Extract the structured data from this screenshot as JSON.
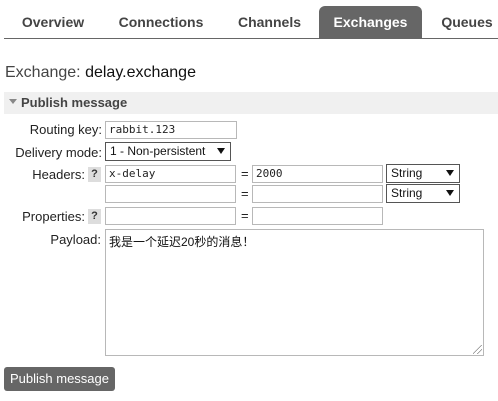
{
  "tabs": [
    {
      "label": "Overview"
    },
    {
      "label": "Connections"
    },
    {
      "label": "Channels"
    },
    {
      "label": "Exchanges",
      "active": true
    },
    {
      "label": "Queues"
    }
  ],
  "title": {
    "prefix": "Exchange:",
    "name": "delay.exchange"
  },
  "section": {
    "label": "Publish message"
  },
  "form": {
    "routing_key": {
      "label": "Routing key:",
      "value": "rabbit.123"
    },
    "delivery_mode": {
      "label": "Delivery mode:",
      "selected": "1 - Non-persistent"
    },
    "headers": {
      "label": "Headers:",
      "help": "?",
      "rows": [
        {
          "key": "x-delay",
          "eq": "=",
          "value": "2000",
          "type": "String"
        },
        {
          "key": "",
          "eq": "=",
          "value": "",
          "type": "String"
        }
      ]
    },
    "properties": {
      "label": "Properties:",
      "help": "?",
      "eq": "=",
      "key": "",
      "value": ""
    },
    "payload": {
      "label": "Payload:",
      "value": "我是一个延迟20秒的消息！"
    }
  },
  "publish_button": {
    "label": "Publish message"
  },
  "colors": {
    "tab_active_bg": "#666666",
    "section_bg": "#f0f0f0",
    "button_bg": "#666666"
  }
}
